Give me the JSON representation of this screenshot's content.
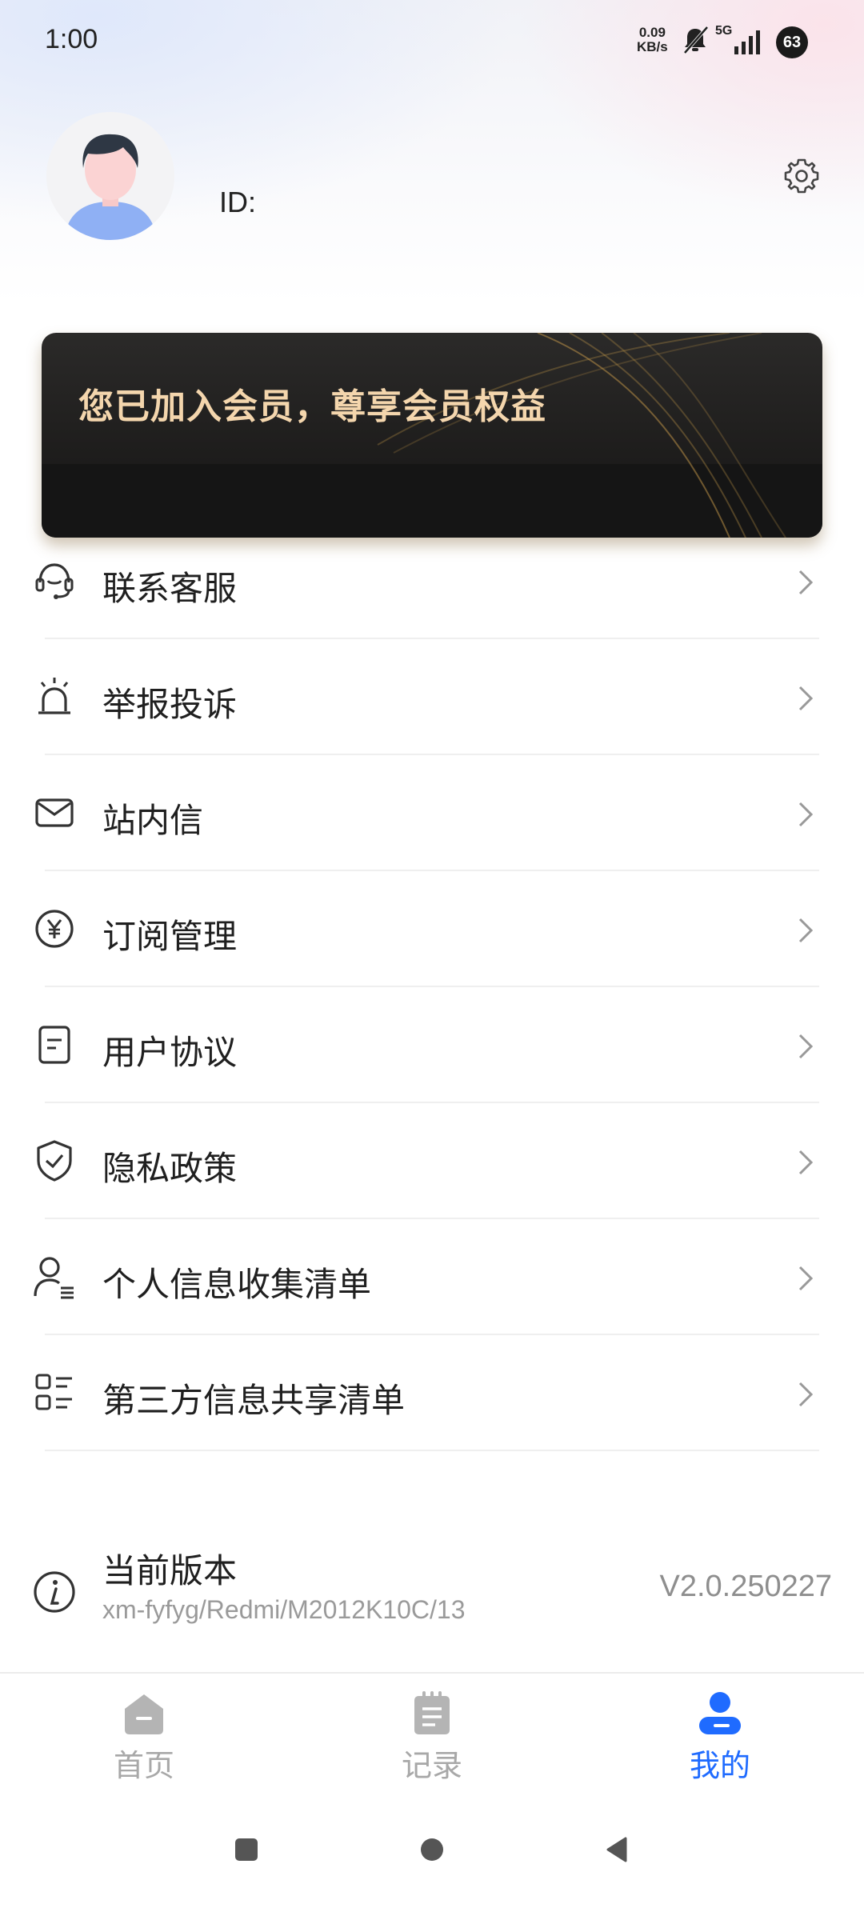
{
  "status_bar": {
    "time": "1:00",
    "net_speed_value": "0.09",
    "net_speed_unit": "KB/s",
    "network_type": "5G",
    "battery": "63"
  },
  "profile": {
    "id_label": "ID:"
  },
  "vip_card": {
    "text": "您已加入会员，尊享会员权益"
  },
  "menu": [
    {
      "label": "联系客服",
      "icon": "headset-icon"
    },
    {
      "label": "举报投诉",
      "icon": "alarm-icon"
    },
    {
      "label": "站内信",
      "icon": "mail-icon"
    },
    {
      "label": "订阅管理",
      "icon": "yen-icon"
    },
    {
      "label": "用户协议",
      "icon": "document-icon"
    },
    {
      "label": "隐私政策",
      "icon": "shield-check-icon"
    },
    {
      "label": "个人信息收集清单",
      "icon": "user-list-icon"
    },
    {
      "label": "第三方信息共享清单",
      "icon": "list-grid-icon"
    }
  ],
  "version": {
    "title": "当前版本",
    "device": "xm-fyfyg/Redmi/M2012K10C/13",
    "number": "V2.0.250227"
  },
  "tabbar": [
    {
      "label": "首页",
      "icon": "home-icon",
      "active": false
    },
    {
      "label": "记录",
      "icon": "clipboard-icon",
      "active": false
    },
    {
      "label": "我的",
      "icon": "user-icon",
      "active": true
    }
  ],
  "colors": {
    "accent": "#1f6bff",
    "vip_text": "#f4d6ad",
    "inactive_tab": "#a8a8a8"
  }
}
